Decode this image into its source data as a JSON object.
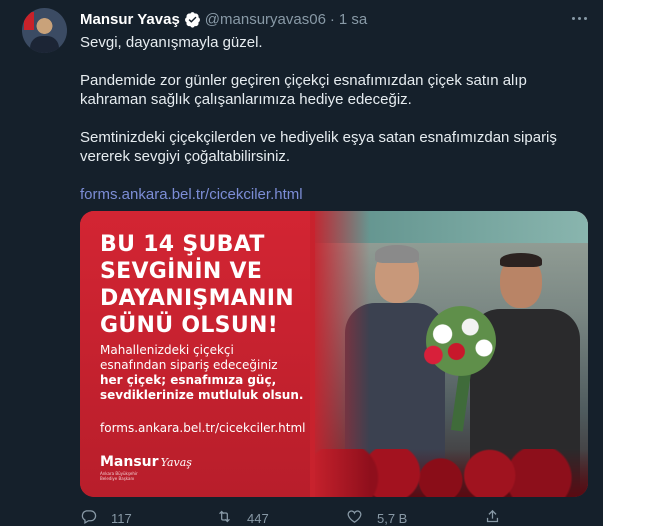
{
  "tweet": {
    "author_name": "Mansur Yavaş",
    "handle": "@mansuryavas06",
    "separator": "·",
    "time": "1 sa",
    "paragraphs": [
      "Sevgi, dayanışmayla güzel.",
      "Pandemide zor günler geçiren çiçekçi esnafımızdan çiçek satın alıp kahraman sağlık çalışanlarımıza hediye edeceğiz.",
      "Semtinizdeki çiçekçilerden ve hediyelik eşya satan esnafımızdan sipariş vererek sevgiyi çoğaltabilirsiniz."
    ],
    "link": "forms.ankara.bel.tr/cicekciler.html"
  },
  "card": {
    "title_lines": [
      "BU 14 ŞUBAT",
      "SEVGİNİN VE",
      "DAYANIŞMANIN",
      "GÜNÜ OLSUN!"
    ],
    "body_lines": [
      "Mahallenizdeki çiçekçi",
      "esnafından sipariş edeceğiniz"
    ],
    "body_bold_lines": [
      "her çiçek; esnafımıza güç,",
      "sevdiklerinize mutluluk olsun."
    ],
    "url": "forms.ankara.bel.tr/cicekciler.html",
    "logo_name": "Mansur",
    "logo_script": "Yavaş",
    "logo_sub_lines": [
      "Ankara Büyükşehir",
      "Belediye Başkanı"
    ]
  },
  "actions": {
    "replies": "117",
    "retweets": "447",
    "likes": "5,7 B"
  },
  "icons": {
    "verified": "verified-badge-icon",
    "more": "more-icon",
    "reply": "reply-icon",
    "retweet": "retweet-icon",
    "like": "heart-icon",
    "share": "share-icon"
  },
  "colors": {
    "background": "#15202b",
    "link": "#7c8dd6",
    "verified": "#ffffff",
    "card_red": "#c8222d"
  }
}
